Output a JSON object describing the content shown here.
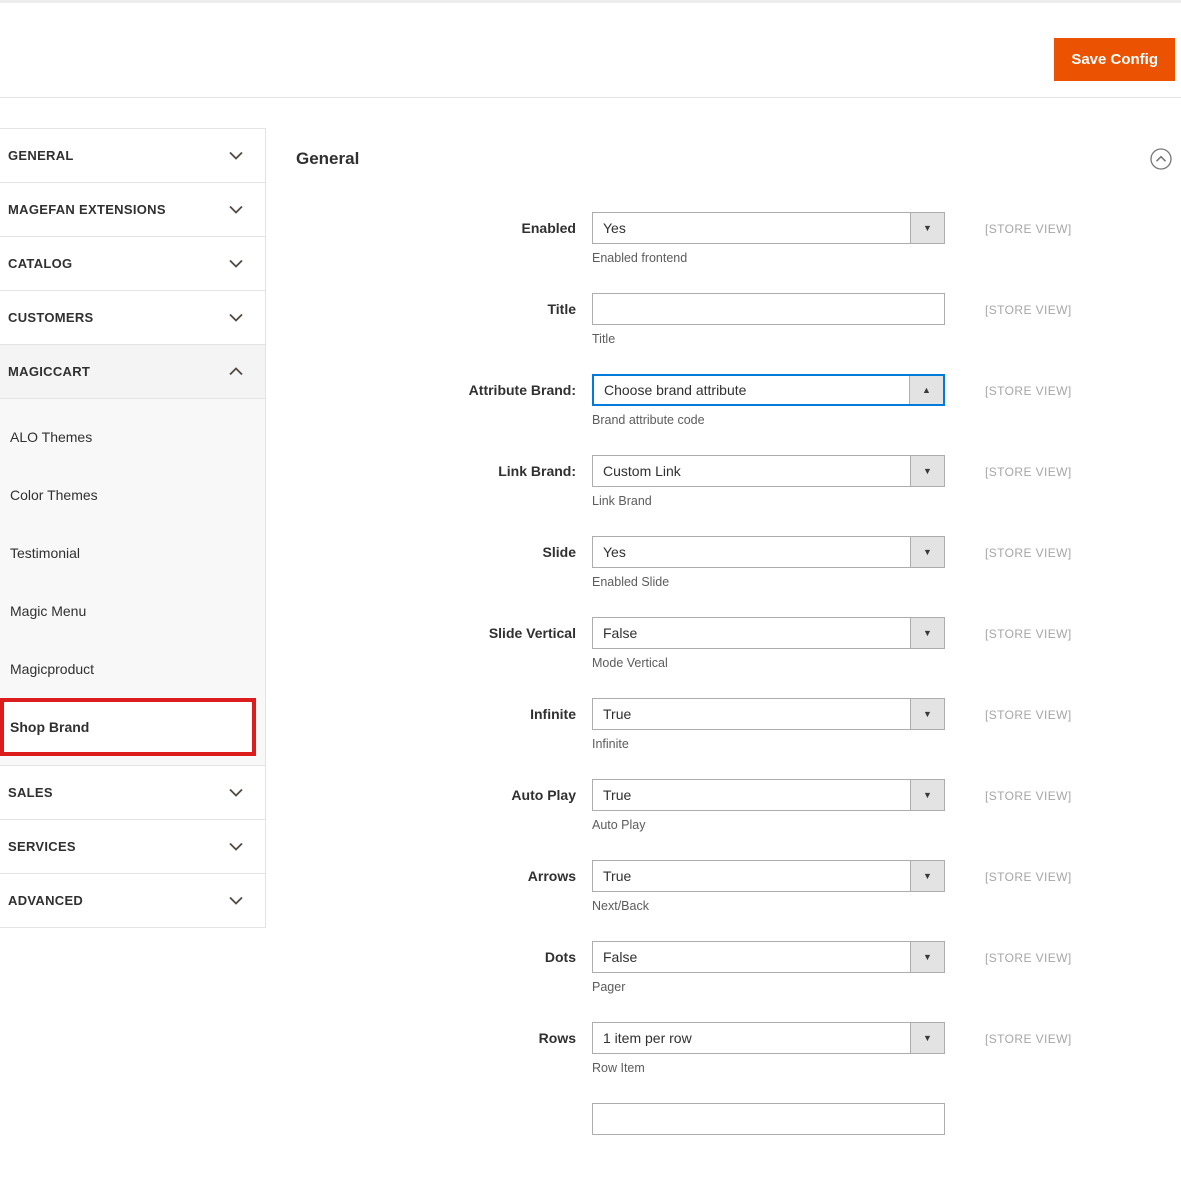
{
  "header": {
    "save_button": "Save Config"
  },
  "colors": {
    "accent_orange": "#eb5202",
    "highlight_red": "#dd1d1d",
    "focus_blue": "#007bdb",
    "scope_gray": "#a6a6a6",
    "border_gray": "#e3e3e3"
  },
  "icons": {
    "caret_down": "▼",
    "caret_up": "▲"
  },
  "sidebar": {
    "sections": [
      {
        "label": "GENERAL",
        "state": "collapsed"
      },
      {
        "label": "MAGEFAN EXTENSIONS",
        "state": "collapsed"
      },
      {
        "label": "CATALOG",
        "state": "collapsed"
      },
      {
        "label": "CUSTOMERS",
        "state": "collapsed"
      },
      {
        "label": "MAGICCART",
        "state": "expanded",
        "children": [
          {
            "label": "ALO Themes"
          },
          {
            "label": "Color Themes"
          },
          {
            "label": "Testimonial"
          },
          {
            "label": "Magic Menu"
          },
          {
            "label": "Magicproduct"
          },
          {
            "label": "Shop Brand",
            "selected": true,
            "highlighted": true
          }
        ]
      },
      {
        "label": "SALES",
        "state": "collapsed"
      },
      {
        "label": "SERVICES",
        "state": "collapsed"
      },
      {
        "label": "ADVANCED",
        "state": "collapsed"
      }
    ]
  },
  "main": {
    "section_title": "General",
    "fields": [
      {
        "label": "Enabled",
        "control": "select",
        "value": "Yes",
        "arrow": "down",
        "helper": "Enabled frontend",
        "scope": "[STORE VIEW]"
      },
      {
        "label": "Title",
        "control": "text",
        "value": "",
        "helper": "Title",
        "scope": "[STORE VIEW]"
      },
      {
        "label": "Attribute Brand:",
        "control": "select",
        "value": "Choose brand attribute",
        "arrow": "up",
        "focused": true,
        "helper": "Brand attribute code",
        "scope": "[STORE VIEW]"
      },
      {
        "label": "Link Brand:",
        "control": "select",
        "value": "Custom Link",
        "arrow": "down",
        "helper": "Link Brand",
        "scope": "[STORE VIEW]"
      },
      {
        "label": "Slide",
        "control": "select",
        "value": "Yes",
        "arrow": "down",
        "helper": "Enabled Slide",
        "scope": "[STORE VIEW]"
      },
      {
        "label": "Slide Vertical",
        "control": "select",
        "value": "False",
        "arrow": "down",
        "helper": "Mode Vertical",
        "scope": "[STORE VIEW]"
      },
      {
        "label": "Infinite",
        "control": "select",
        "value": "True",
        "arrow": "down",
        "helper": "Infinite",
        "scope": "[STORE VIEW]"
      },
      {
        "label": "Auto Play",
        "control": "select",
        "value": "True",
        "arrow": "down",
        "helper": "Auto Play",
        "scope": "[STORE VIEW]"
      },
      {
        "label": "Arrows",
        "control": "select",
        "value": "True",
        "arrow": "down",
        "helper": "Next/Back",
        "scope": "[STORE VIEW]"
      },
      {
        "label": "Dots",
        "control": "select",
        "value": "False",
        "arrow": "down",
        "helper": "Pager",
        "scope": "[STORE VIEW]"
      },
      {
        "label": "Rows",
        "control": "select",
        "value": "1 item per row",
        "arrow": "down",
        "helper": "Row Item",
        "scope": "[STORE VIEW]"
      }
    ],
    "partial_next_field_visible": true
  }
}
